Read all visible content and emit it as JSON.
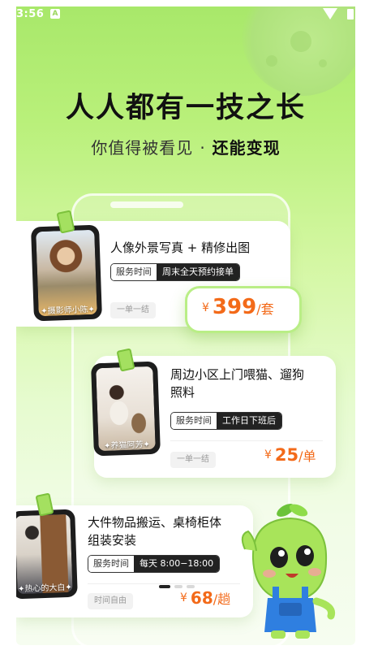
{
  "status_bar": {
    "time": "3:56",
    "app_badge": "A"
  },
  "hero": {
    "headline": "人人都有一技之长",
    "sub_left": "你值得被看见",
    "sub_dot": "·",
    "sub_right": "还能变现"
  },
  "cards": [
    {
      "person": "摄影师小陈",
      "title": "人像外景写真 + 精修出图",
      "tag_key": "服务时间",
      "tag_value": "周末全天预约接单",
      "chip": "一单一结",
      "currency": "¥",
      "price": "399",
      "unit": "/套"
    },
    {
      "person": "养猫阿芳",
      "title_line1": "周边小区上门喂猫、遛狗",
      "title_line2": "照料",
      "tag_key": "服务时间",
      "tag_value": "工作日下班后",
      "chip": "一单一结",
      "currency": "¥",
      "price": "25",
      "unit": "/单"
    },
    {
      "person": "热心的大白",
      "title_line1": "大件物品搬运、桌椅柜体",
      "title_line2": "组装安装",
      "tag_key": "服务时间",
      "tag_value": "每天 8:00−18:00",
      "chip": "时间自由",
      "currency": "¥",
      "price": "68",
      "unit": "/趟"
    }
  ],
  "pager": {
    "count": 3,
    "active_index": 0
  },
  "colors": {
    "price": "#f36a19",
    "bg_top": "#a8e86a",
    "bg_bottom": "#f6fdf0",
    "accent_green": "#a4e060"
  },
  "icons": [
    "wifi-icon",
    "battery-icon",
    "mascot-icon"
  ]
}
